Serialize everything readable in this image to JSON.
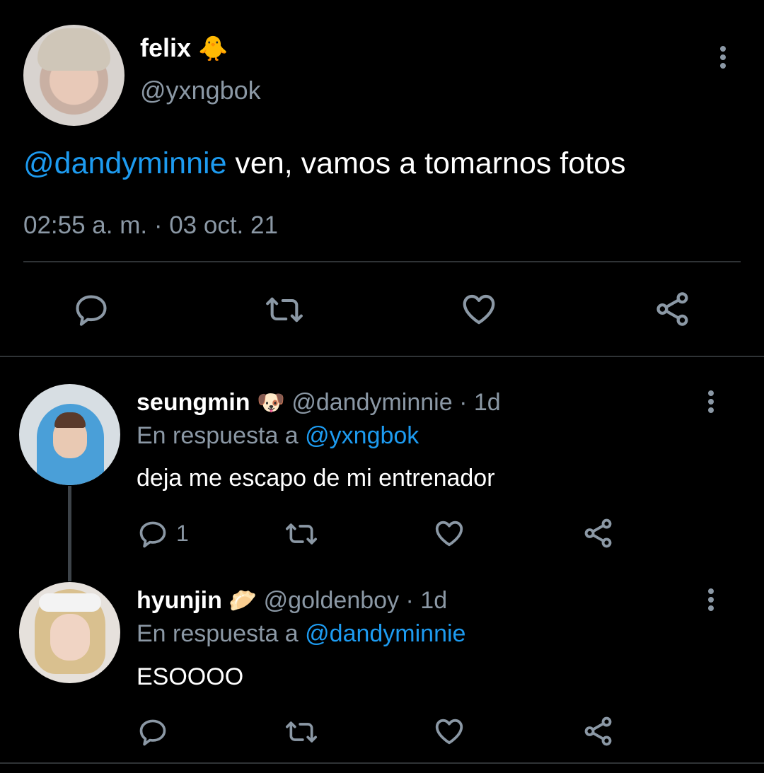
{
  "main_tweet": {
    "display_name": "felix",
    "emoji": "🐥",
    "handle": "@yxngbok",
    "mention": "@dandyminnie",
    "text": " ven, vamos a tomarnos fotos",
    "timestamp": "02:55 a. m. · 03 oct. 21"
  },
  "replies": [
    {
      "display_name": "seungmin",
      "emoji": "🐶",
      "handle_time": "@dandyminnie · 1d",
      "reply_prefix": "En respuesta a ",
      "reply_to": "@yxngbok",
      "text": "deja me escapo de mi entrenador",
      "reply_count": "1"
    },
    {
      "display_name": "hyunjin",
      "emoji": "🥟",
      "handle_time": "@goldenboy · 1d",
      "reply_prefix": "En respuesta a ",
      "reply_to": "@dandyminnie",
      "text": "ESOOOO",
      "reply_count": ""
    }
  ],
  "colors": {
    "background": "#000000",
    "link": "#1d9bf0",
    "muted": "#8b98a5",
    "divider": "#2f3336"
  },
  "icons": [
    "reply-icon",
    "retweet-icon",
    "like-icon",
    "share-icon",
    "more-options-icon"
  ]
}
